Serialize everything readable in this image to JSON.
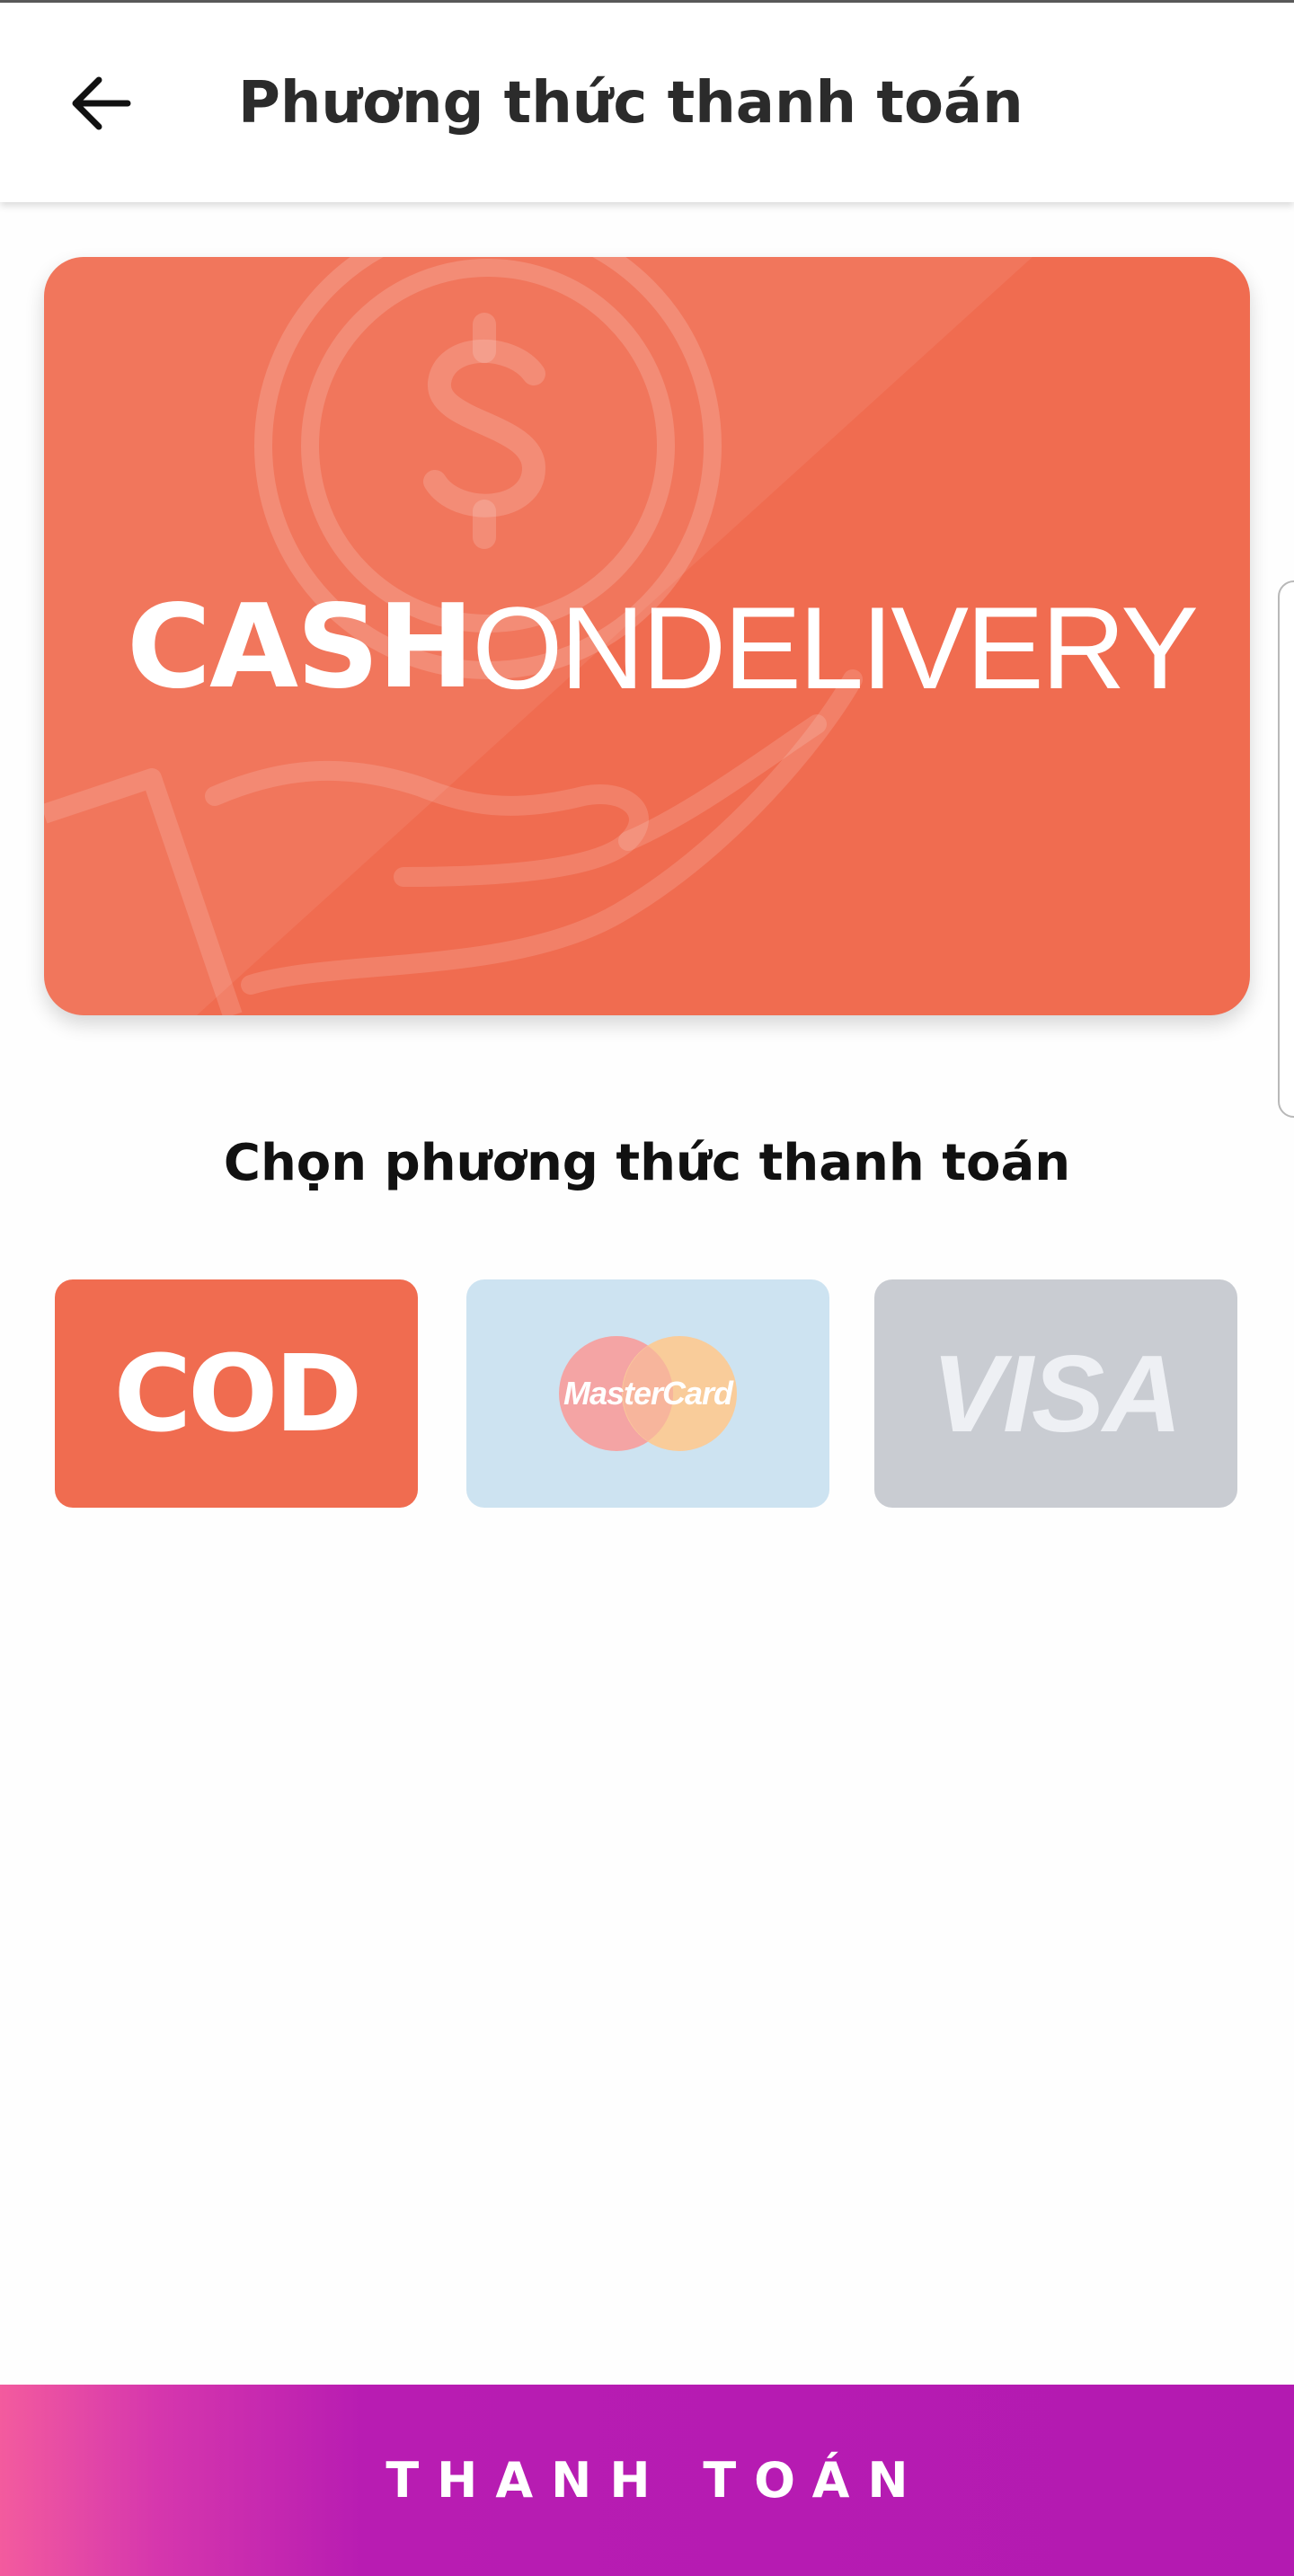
{
  "header": {
    "back_icon": "arrow-left-icon",
    "title": "Phương thức thanh toán"
  },
  "hero": {
    "text_bold": "CASH",
    "text_light": "ONDELIVERY",
    "background_color": "#f06c50",
    "decoration_icon": "coin-in-hand-icon"
  },
  "section": {
    "title": "Chọn phương thức thanh toán"
  },
  "payment_options": [
    {
      "label": "COD",
      "icon": "cod-logo",
      "background_color": "#f06c50",
      "selected": true
    },
    {
      "label": "MasterCard",
      "icon": "mastercard-logo",
      "background_color": "#cde3f1",
      "selected": false
    },
    {
      "label": "VISA",
      "icon": "visa-logo",
      "background_color": "#c9ccd2",
      "selected": false
    }
  ],
  "pay_button": {
    "label": "THANH TOÁN",
    "gradient_colors": [
      "#f35b9e",
      "#b31ab1"
    ]
  }
}
